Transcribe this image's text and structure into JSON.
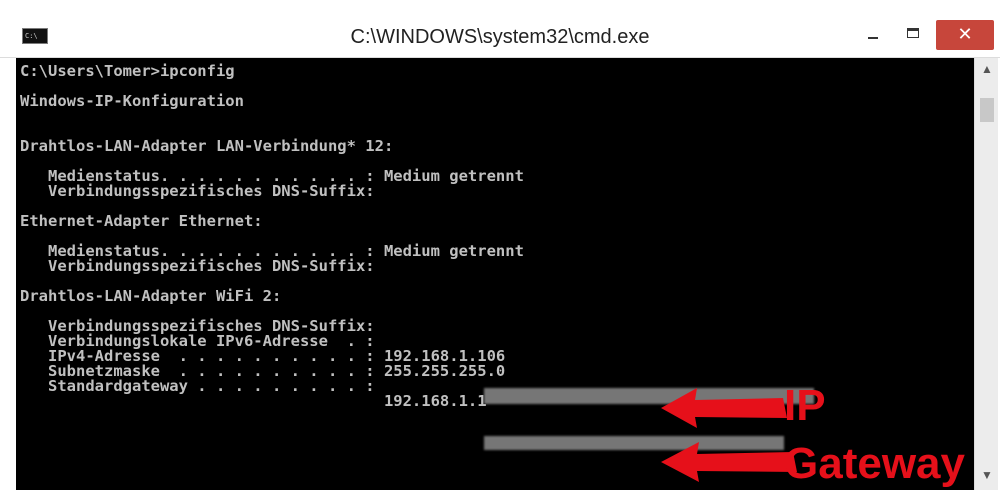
{
  "window": {
    "title": "C:\\WINDOWS\\system32\\cmd.exe",
    "icon": "cmd-icon",
    "icon_text": "C:\\",
    "controls": {
      "minimize": "minimize-icon",
      "maximize": "maximize-icon",
      "close_label": "✕"
    }
  },
  "console": {
    "lines": [
      "C:\\Users\\Tomer>ipconfig",
      "",
      "Windows-IP-Konfiguration",
      "",
      "",
      "Drahtlos-LAN-Adapter LAN-Verbindung* 12:",
      "",
      "   Medienstatus. . . . . . . . . . . : Medium getrennt",
      "   Verbindungsspezifisches DNS-Suffix:",
      "",
      "Ethernet-Adapter Ethernet:",
      "",
      "   Medienstatus. . . . . . . . . . . : Medium getrennt",
      "   Verbindungsspezifisches DNS-Suffix:",
      "",
      "Drahtlos-LAN-Adapter WiFi 2:",
      "",
      "   Verbindungsspezifisches DNS-Suffix:",
      "   Verbindungslokale IPv6-Adresse  . :",
      "   IPv4-Adresse  . . . . . . . . . . : 192.168.1.106",
      "   Subnetzmaske  . . . . . . . . . . : 255.255.255.0",
      "   Standardgateway . . . . . . . . . :",
      "                                       192.168.1.1"
    ]
  },
  "annotations": {
    "ip_label": "IP",
    "gateway_label": "Gateway",
    "color": "#e6101a"
  },
  "scrollbar": {
    "up": "▲",
    "down": "▼"
  }
}
